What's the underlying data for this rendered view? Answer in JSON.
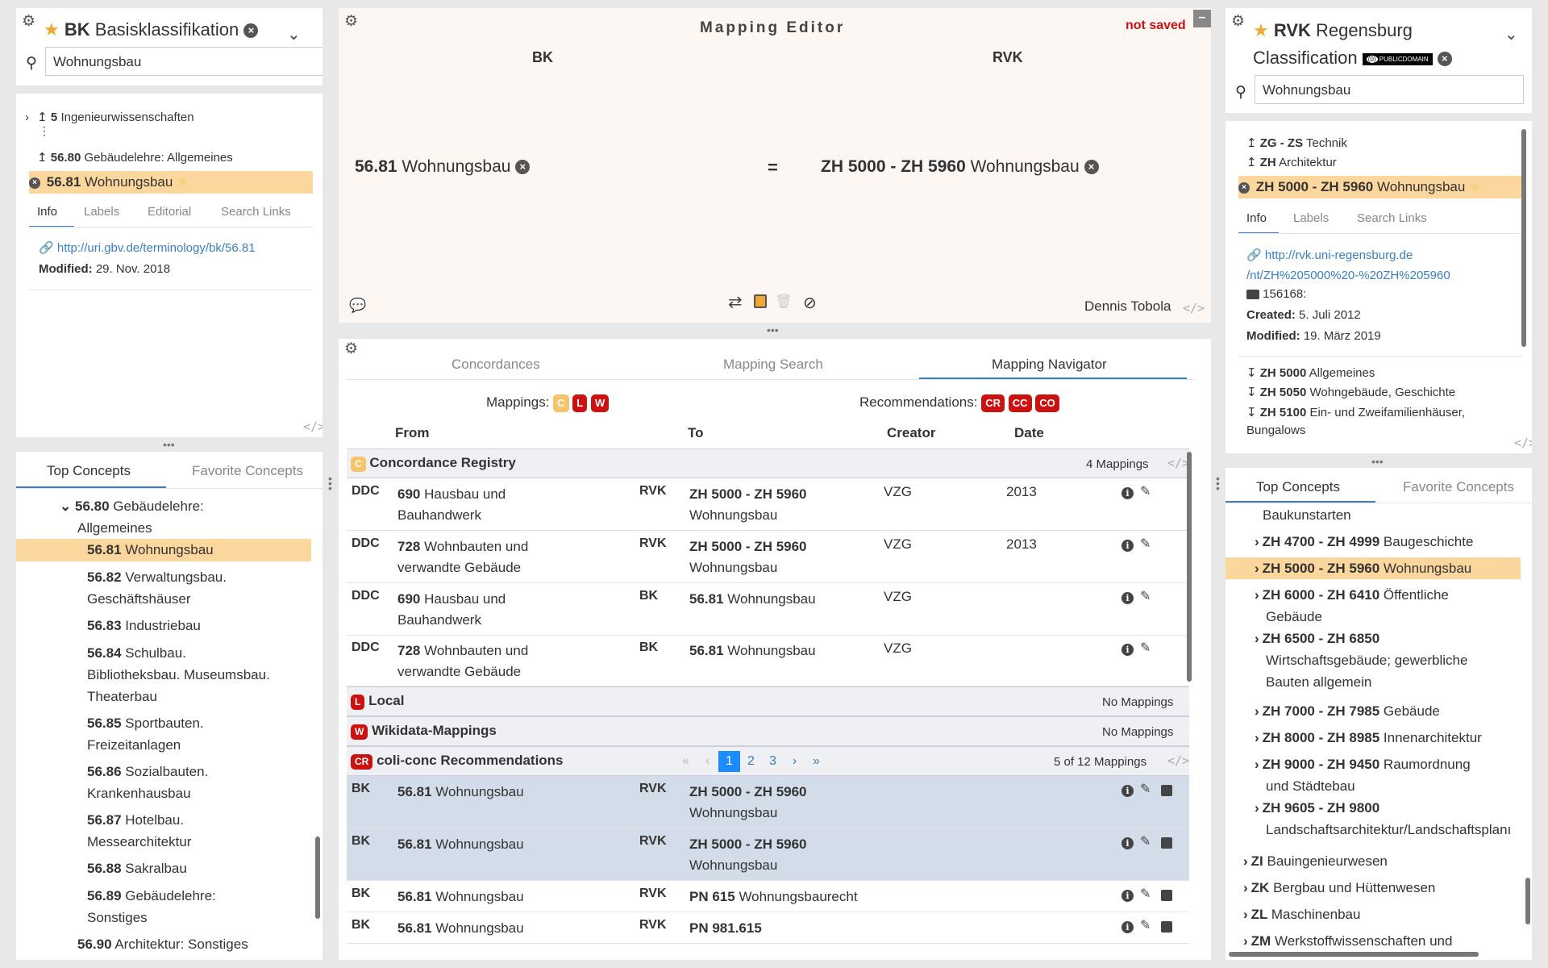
{
  "left": {
    "title_code": "BK",
    "title_name": "Basisklassifikation",
    "search_value": "Wohnungsbau",
    "tree": [
      {
        "code": "5",
        "label": "Ingenieurwissenschaften"
      },
      {
        "code": "56.80",
        "label": "Gebäudelehre: Allgemeines"
      },
      {
        "code": "56.81",
        "label": "Wohnungsbau"
      }
    ],
    "tabs": [
      "Info",
      "Labels",
      "Editorial",
      "Search Links"
    ],
    "uri": "http://uri.gbv.de/terminology/bk/56.81",
    "modified_label": "Modified:",
    "modified_value": "29. Nov. 2018",
    "list_tabs": [
      "Top Concepts",
      "Favorite Concepts"
    ],
    "list": [
      {
        "code": "56.80",
        "l1": "Gebäudelehre:",
        "l2": "Allgemeines"
      },
      {
        "code": "56.81",
        "l1": "Wohnungsbau",
        "l2": ""
      },
      {
        "code": "56.82",
        "l1": "Verwaltungsbau.",
        "l2": "Geschäftshäuser"
      },
      {
        "code": "56.83",
        "l1": "Industriebau",
        "l2": ""
      },
      {
        "code": "56.84",
        "l1": "Schulbau.",
        "l2": "Bibliotheksbau. Museumsbau.",
        "l3": "Theaterbau"
      },
      {
        "code": "56.85",
        "l1": "Sportbauten.",
        "l2": "Freizeitanlagen"
      },
      {
        "code": "56.86",
        "l1": "Sozialbauten.",
        "l2": "Krankenhausbau"
      },
      {
        "code": "56.87",
        "l1": "Hotelbau.",
        "l2": "Messearchitektur"
      },
      {
        "code": "56.88",
        "l1": "Sakralbau",
        "l2": ""
      },
      {
        "code": "56.89",
        "l1": "Gebäudelehre:",
        "l2": "Sonstiges"
      },
      {
        "code": "56.90",
        "l1": "Architektur: Sonstiges",
        "l2": ""
      }
    ]
  },
  "editor": {
    "title": "Mapping Editor",
    "status": "not saved",
    "from_scheme": "BK",
    "to_scheme": "RVK",
    "from_code": "56.81",
    "from_label": "Wohnungsbau",
    "relation": "=",
    "to_code": "ZH 5000 - ZH 5960",
    "to_label": "Wohnungsbau",
    "creator": "Dennis Tobola"
  },
  "nav": {
    "tabs": [
      "Concordances",
      "Mapping Search",
      "Mapping Navigator"
    ],
    "mappings_label": "Mappings:",
    "mapping_badges": [
      "C",
      "L",
      "W"
    ],
    "recommendations_label": "Recommendations:",
    "rec_badges": [
      "CR",
      "CC",
      "CO"
    ],
    "headers": {
      "from": "From",
      "to": "To",
      "creator": "Creator",
      "date": "Date"
    },
    "groups": [
      {
        "badge": "C",
        "name": "Concordance Registry",
        "count": "4 Mappings"
      },
      {
        "badge": "L",
        "name": "Local",
        "count": "No Mappings"
      },
      {
        "badge": "W",
        "name": "Wikidata-Mappings",
        "count": "No Mappings"
      },
      {
        "badge": "CR",
        "name": "coli-conc Recommendations",
        "count": "5 of 12 Mappings"
      }
    ],
    "registry_rows": [
      {
        "fs": "DDC",
        "fc": "690",
        "fl1": "Hausbau und",
        "fl2": "Bauhandwerk",
        "ts": "RVK",
        "tc": "ZH 5000 - ZH 5960",
        "tl": "Wohnungsbau",
        "creator": "VZG",
        "date": "2013"
      },
      {
        "fs": "DDC",
        "fc": "728",
        "fl1": "Wohnbauten und",
        "fl2": "verwandte Gebäude",
        "ts": "RVK",
        "tc": "ZH 5000 - ZH 5960",
        "tl": "Wohnungsbau",
        "creator": "VZG",
        "date": "2013"
      },
      {
        "fs": "DDC",
        "fc": "690",
        "fl1": "Hausbau und",
        "fl2": "Bauhandwerk",
        "ts": "BK",
        "tc": "56.81",
        "tl": "Wohnungsbau",
        "creator": "VZG",
        "date": ""
      },
      {
        "fs": "DDC",
        "fc": "728",
        "fl1": "Wohnbauten und",
        "fl2": "verwandte Gebäude",
        "ts": "BK",
        "tc": "56.81",
        "tl": "Wohnungsbau",
        "creator": "VZG",
        "date": ""
      }
    ],
    "rec_rows": [
      {
        "fs": "BK",
        "fc": "56.81",
        "fl": "Wohnungsbau",
        "ts": "RVK",
        "tc": "ZH 5000 - ZH 5960",
        "tl": "Wohnungsbau"
      },
      {
        "fs": "BK",
        "fc": "56.81",
        "fl": "Wohnungsbau",
        "ts": "RVK",
        "tc": "ZH 5000 - ZH 5960",
        "tl": "Wohnungsbau"
      },
      {
        "fs": "BK",
        "fc": "56.81",
        "fl": "Wohnungsbau",
        "ts": "RVK",
        "tc": "PN 615",
        "tl": "Wohnungsbaurecht"
      },
      {
        "fs": "BK",
        "fc": "56.81",
        "fl": "Wohnungsbau",
        "ts": "RVK",
        "tc": "PN 981.615",
        "tl": ""
      }
    ],
    "pager": [
      "«",
      "‹",
      "1",
      "2",
      "3",
      "›",
      "»"
    ]
  },
  "right": {
    "title_code": "RVK",
    "title_name": "Regensburg",
    "title_name2": "Classification",
    "license": "PUBLICDOMAIN",
    "search_value": "Wohnungsbau",
    "tree": [
      {
        "code": "ZG - ZS",
        "label": "Technik"
      },
      {
        "code": "ZH",
        "label": "Architektur"
      },
      {
        "code": "ZH 5000 - ZH 5960",
        "label": "Wohnungsbau"
      }
    ],
    "tabs": [
      "Info",
      "Labels",
      "Search Links"
    ],
    "uri1": "http://rvk.uni-regensburg.de",
    "uri2": "/nt/ZH%205000%20-%20ZH%205960",
    "id": "156168:",
    "created_label": "Created:",
    "created_value": "5. Juli 2012",
    "modified_label": "Modified:",
    "modified_value": "19. März 2019",
    "narrower": [
      {
        "code": "ZH 5000",
        "label": "Allgemeines"
      },
      {
        "code": "ZH 5050",
        "label": "Wohngebäude, Geschichte"
      },
      {
        "code": "ZH 5100",
        "label": "Ein- und Zweifamilienhäuser,",
        "label2": "Bungalows"
      }
    ],
    "list_tabs": [
      "Top Concepts",
      "Favorite Concepts"
    ],
    "list": [
      {
        "code": "",
        "l1": "Baukunstarten"
      },
      {
        "code": "ZH 4700 - ZH 4999",
        "l1": "Baugeschichte"
      },
      {
        "code": "ZH 5000 - ZH 5960",
        "l1": "Wohnungsbau"
      },
      {
        "code": "ZH 6000 - ZH 6410",
        "l1": "Öffentliche",
        "l2": "Gebäude"
      },
      {
        "code": "ZH 6500 - ZH 6850",
        "l1": "",
        "l2": "Wirtschaftsgebäude; gewerbliche",
        "l3": "Bauten allgemein"
      },
      {
        "code": "ZH 7000 - ZH 7985",
        "l1": "Gebäude"
      },
      {
        "code": "ZH 8000 - ZH 8985",
        "l1": "Innenarchitektur"
      },
      {
        "code": "ZH 9000 - ZH 9450",
        "l1": "Raumordnung",
        "l2": "und Städtebau"
      },
      {
        "code": "ZH 9605 - ZH 9800",
        "l1": "",
        "l2": "Landschaftsarchitektur/Landschaftsplanı"
      },
      {
        "code": "ZI",
        "l1": "Bauingenieurwesen"
      },
      {
        "code": "ZK",
        "l1": "Bergbau und Hüttenwesen"
      },
      {
        "code": "ZL",
        "l1": "Maschinenbau"
      },
      {
        "code": "ZM",
        "l1": "Werkstoffwissenschaften und"
      }
    ]
  }
}
